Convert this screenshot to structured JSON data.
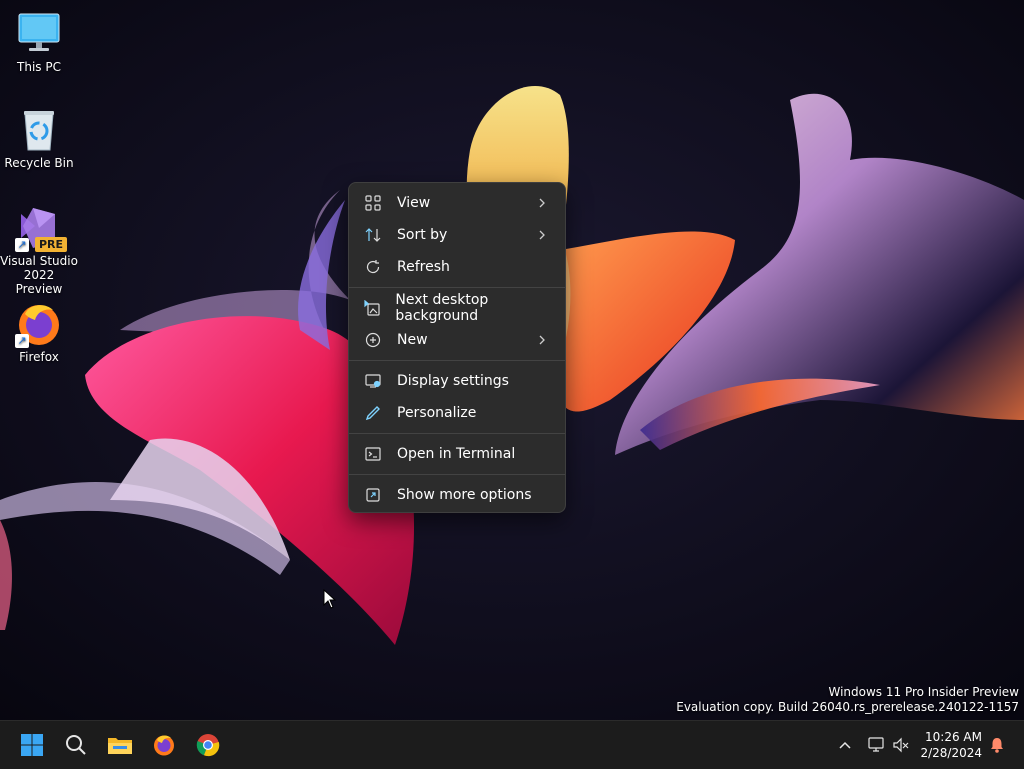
{
  "desktop": {
    "icons": [
      {
        "label": "This PC",
        "icon": "monitor-icon"
      },
      {
        "label": "Recycle Bin",
        "icon": "recycle-bin-icon"
      },
      {
        "label": "Visual Studio 2022 Preview",
        "icon": "visual-studio-icon",
        "badge": "PRE"
      },
      {
        "label": "Firefox",
        "icon": "firefox-icon"
      }
    ]
  },
  "context_menu": {
    "items": [
      {
        "label": "View",
        "icon": "view-grid-icon",
        "submenu": true
      },
      {
        "label": "Sort by",
        "icon": "sort-icon",
        "submenu": true
      },
      {
        "label": "Refresh",
        "icon": "refresh-icon",
        "submenu": false
      },
      {
        "label": "Next desktop background",
        "icon": "next-background-icon",
        "submenu": false
      },
      {
        "label": "New",
        "icon": "new-plus-icon",
        "submenu": true
      },
      {
        "label": "Display settings",
        "icon": "display-settings-icon",
        "submenu": false
      },
      {
        "label": "Personalize",
        "icon": "personalize-pen-icon",
        "submenu": false
      },
      {
        "label": "Open in Terminal",
        "icon": "terminal-icon",
        "submenu": false
      },
      {
        "label": "Show more options",
        "icon": "more-options-icon",
        "submenu": false
      }
    ]
  },
  "watermark": {
    "line1": "Windows 11 Pro Insider Preview",
    "line2": "Evaluation copy. Build 26040.rs_prerelease.240122-1157"
  },
  "taskbar": {
    "apps": [
      "start-icon",
      "search-icon",
      "file-explorer-icon",
      "firefox-icon",
      "chrome-icon"
    ],
    "tray": [
      "chevron-up-icon",
      "network-icon",
      "volume-muted-icon"
    ],
    "time": "10:26 AM",
    "date": "2/28/2024",
    "notification_icon": "bell-icon"
  },
  "colors": {
    "taskbar": "#1c1c1c",
    "menu_bg": "#2c2c2c",
    "accent": "#60cdff"
  }
}
